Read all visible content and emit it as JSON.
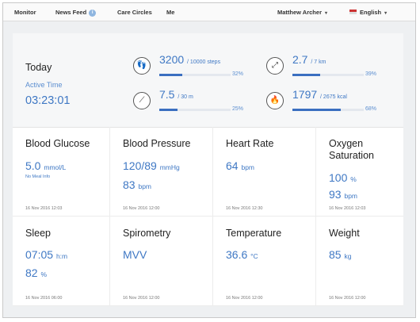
{
  "nav": {
    "items": [
      "Monitor",
      "News Feed",
      "Care Circles",
      "Me"
    ],
    "user": "Matthew Archer",
    "language": "English"
  },
  "today": {
    "title": "Today",
    "active_time_label": "Active Time",
    "active_time_value": "03:23:01",
    "stats": [
      {
        "icon": "footsteps-icon",
        "value": "3200",
        "unit": "/ 10000 steps",
        "percent_label": "32%",
        "fraction": 0.32
      },
      {
        "icon": "distance-icon",
        "value": "2.7",
        "unit": "/ 7 km",
        "percent_label": "39%",
        "fraction": 0.39
      },
      {
        "icon": "stairs-icon",
        "value": "7.5",
        "unit": "/ 30 m",
        "percent_label": "25%",
        "fraction": 0.25
      },
      {
        "icon": "flame-icon",
        "value": "1797",
        "unit": "/ 2675 kcal",
        "percent_label": "68%",
        "fraction": 0.68
      }
    ]
  },
  "metrics": [
    {
      "name": "Blood Glucose",
      "value1": "5.0",
      "unit1": "mmol/L",
      "note": "No Meal Info",
      "time": "16 Nov 2016 12:03"
    },
    {
      "name": "Blood Pressure",
      "value1": "120/89",
      "unit1": "mmHg",
      "value2": "83",
      "unit2": "bpm",
      "time": "16 Nov 2016 12:00"
    },
    {
      "name": "Heart Rate",
      "value1": "64",
      "unit1": "bpm",
      "time": "16 Nov 2016 12:30"
    },
    {
      "name": "Oxygen Saturation",
      "value1": "100",
      "unit1": "%",
      "value2": "93",
      "unit2": "bpm",
      "time": "16 Nov 2016 12:03"
    },
    {
      "name": "Sleep",
      "value1": "07:05",
      "unit1": "h:m",
      "value2": "82",
      "unit2": "%",
      "time": "16 Nov 2016 06:00"
    },
    {
      "name": "Spirometry",
      "value1": "MVV",
      "unit1": "",
      "time": "16 Nov 2016 12:00"
    },
    {
      "name": "Temperature",
      "value1": "36.6",
      "unit1": "°C",
      "time": "16 Nov 2016 12:00"
    },
    {
      "name": "Weight",
      "value1": "85",
      "unit1": "kg",
      "time": "16 Nov 2016 12:00"
    }
  ]
}
